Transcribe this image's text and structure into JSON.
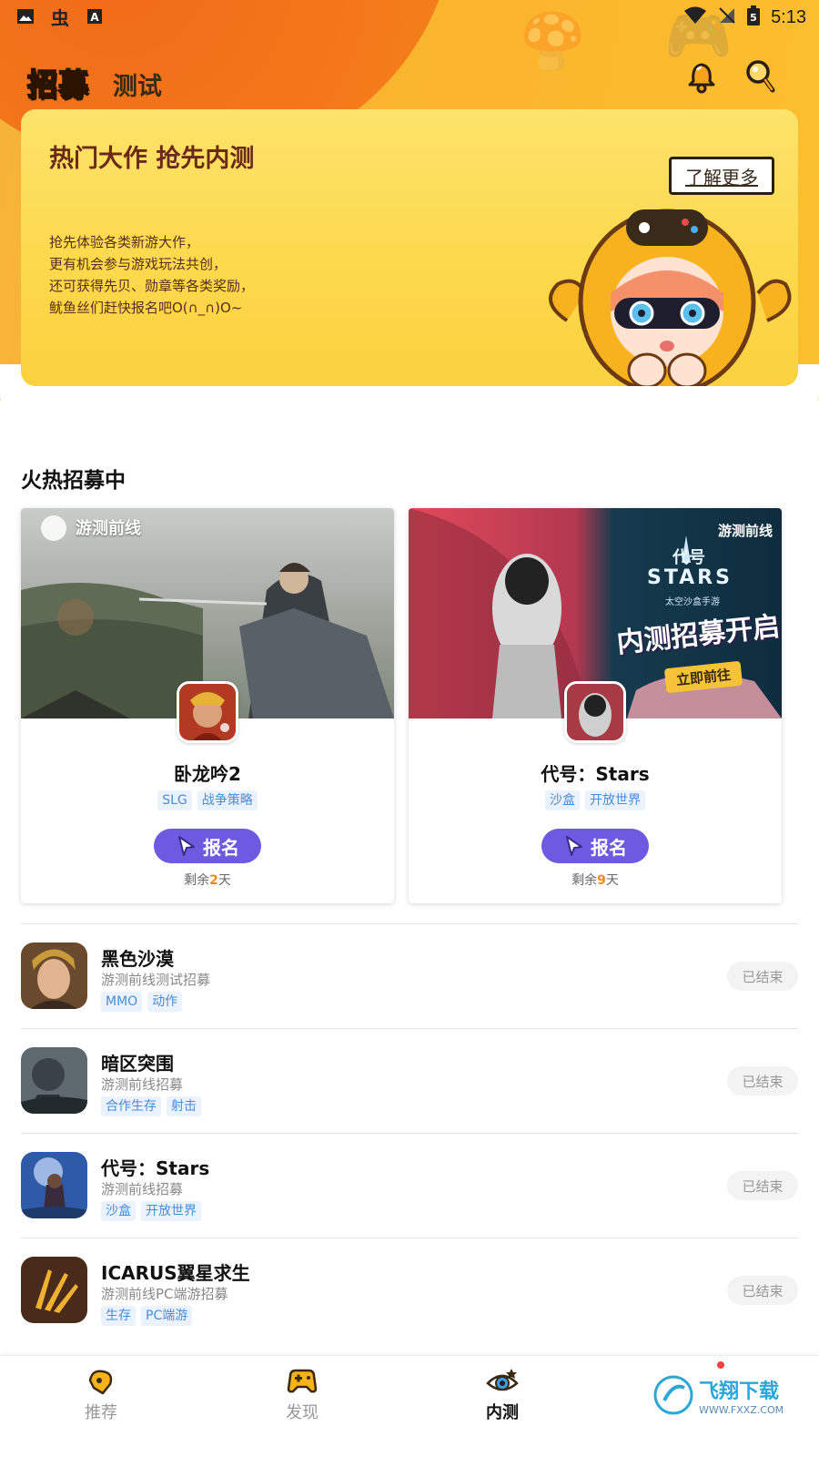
{
  "status_bar": {
    "left_icons": [
      "image-icon",
      "bug-icon",
      "a-icon"
    ],
    "right_icons": [
      "wifi-icon",
      "signal-off-icon",
      "battery-icon"
    ],
    "battery_level": "5",
    "time": "5:13"
  },
  "header": {
    "tab_active": "招募",
    "tab_inactive": "测试",
    "actions": [
      "bell-icon",
      "search-icon"
    ]
  },
  "banner": {
    "title": "热门大作 抢先内测",
    "desc_lines": [
      "抢先体验各类新游大作，",
      "更有机会参与游戏玩法共创，",
      "还可获得先贝、勋章等各类奖励，",
      "鱿鱼丝们赶快报名吧O(∩_∩)O~"
    ],
    "more_label": "了解更多"
  },
  "section": {
    "title": "火热招募中"
  },
  "cards": [
    {
      "cover_watermark": "游测前线",
      "title": "卧龙吟2",
      "tags": [
        "SLG",
        "战争策略"
      ],
      "button_label": "报名",
      "remain_prefix": "剩余",
      "remain_days": "2",
      "remain_suffix": "天"
    },
    {
      "cover_watermark": "游测前线",
      "cover_logo_top": "代号",
      "cover_logo": "STARS",
      "cover_logo_sub": "太空沙盒手游",
      "cover_slogan": "内测招募开启",
      "cover_cta": "立即前往",
      "title": "代号：Stars",
      "tags": [
        "沙盒",
        "开放世界"
      ],
      "button_label": "报名",
      "remain_prefix": "剩余",
      "remain_days": "9",
      "remain_suffix": "天"
    }
  ],
  "list": [
    {
      "name": "黑色沙漠",
      "sub": "游测前线测试招募",
      "tags": [
        "MMO",
        "动作"
      ],
      "status": "已结束"
    },
    {
      "name": "暗区突围",
      "sub": "游测前线招募",
      "tags": [
        "合作生存",
        "射击"
      ],
      "status": "已结束"
    },
    {
      "name": "代号：Stars",
      "sub": "游测前线招募",
      "tags": [
        "沙盒",
        "开放世界"
      ],
      "status": "已结束"
    },
    {
      "name": "ICARUS翼星求生",
      "sub": "游测前线PC端游招募",
      "tags": [
        "生存",
        "PC端游"
      ],
      "status": "已结束"
    }
  ],
  "bottom_nav": {
    "items": [
      {
        "label": "推荐",
        "icon": "recommend-icon",
        "active": false
      },
      {
        "label": "发现",
        "icon": "gamepad-icon",
        "active": false
      },
      {
        "label": "内测",
        "icon": "eye-icon",
        "active": true
      }
    ],
    "watermark_text": "飞翔下载",
    "watermark_url": "WWW.FXXZ.COM"
  },
  "colors": {
    "accent": "#6c5ae0",
    "header_orange": "#f06a1a",
    "header_yellow": "#fbb52d",
    "tag_text": "#4a8ad8",
    "tag_bg": "#eaf3fd",
    "remain_highlight": "#f08a1c"
  }
}
